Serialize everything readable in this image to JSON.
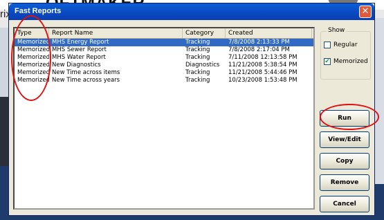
{
  "background": {
    "brand_text": "OFTMAKER",
    "brand_sub": "rix"
  },
  "dialog": {
    "title": "Fast Reports",
    "close_glyph": "✕"
  },
  "table": {
    "columns": [
      "Type",
      "Report Name",
      "Category",
      "Created"
    ],
    "rows": [
      {
        "type": "Memorized",
        "name": "MHS Energy Report",
        "category": "Tracking",
        "created": "7/8/2008 2:13:33 PM",
        "selected": true
      },
      {
        "type": "Memorized",
        "name": "MHS Sewer Report",
        "category": "Tracking",
        "created": "7/8/2008 2:17:04 PM",
        "selected": false
      },
      {
        "type": "Memorized",
        "name": "MHS Water Report",
        "category": "Tracking",
        "created": "7/11/2008 12:13:58 PM",
        "selected": false
      },
      {
        "type": "Memorized",
        "name": "New Diagnostics",
        "category": "Diagnostics",
        "created": "11/21/2008 5:38:54 PM",
        "selected": false
      },
      {
        "type": "Memorized",
        "name": "New Time across items",
        "category": "Tracking",
        "created": "11/21/2008 5:44:46 PM",
        "selected": false
      },
      {
        "type": "Memorized",
        "name": "New Time across years",
        "category": "Tracking",
        "created": "10/23/2008 1:53:48 PM",
        "selected": false
      }
    ]
  },
  "show": {
    "legend": "Show",
    "regular_label": "Regular",
    "regular_checked": false,
    "memorized_label": "Memorized",
    "memorized_checked": true,
    "check_glyph": "✔"
  },
  "buttons": {
    "run": "Run",
    "view_edit": "View/Edit",
    "copy": "Copy",
    "remove": "Remove",
    "cancel": "Cancel"
  },
  "colors": {
    "selection": "#316ac5",
    "titlebar": "#0a48c0",
    "annotation": "#e01010"
  }
}
